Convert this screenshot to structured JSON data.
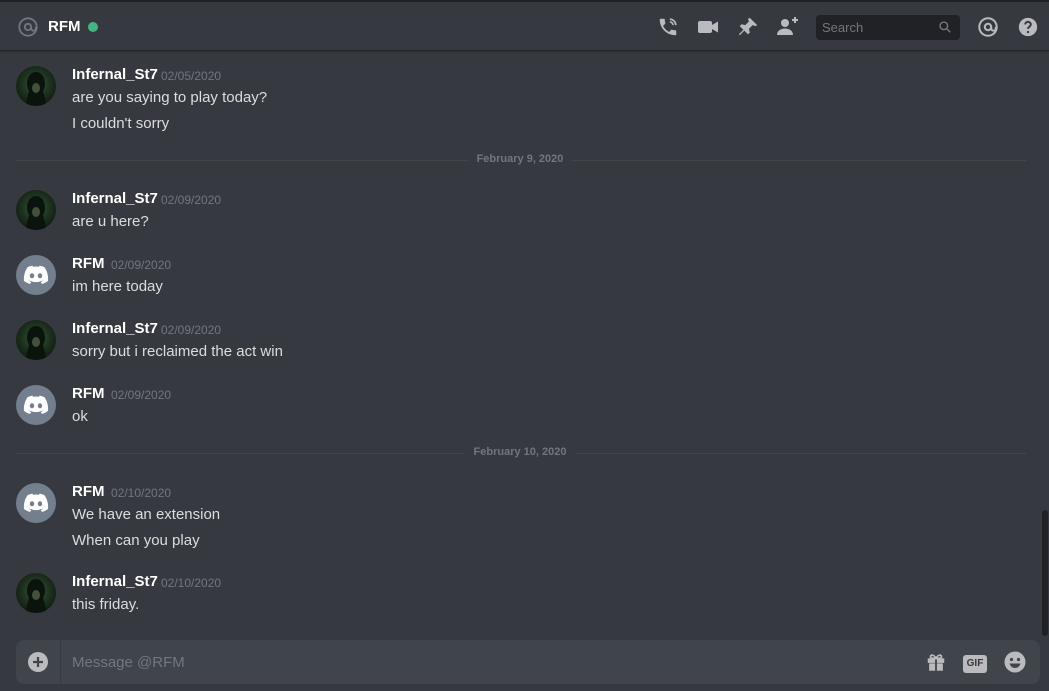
{
  "header": {
    "title": "RFM",
    "status_color": "#43b581",
    "icons": [
      "at-icon",
      "voice-call-icon",
      "video-call-icon",
      "pin-icon",
      "add-friend-icon",
      "mention-icon",
      "help-icon"
    ],
    "search_placeholder": "Search"
  },
  "messages": [
    {
      "author": "Infernal_St7",
      "timestamp": "02/05/2020",
      "lines": [
        "are you saying to play today?",
        "I couldn't sorry"
      ]
    },
    {
      "author": "Infernal_St7",
      "timestamp": "02/09/2020",
      "lines": [
        "are u here?"
      ]
    },
    {
      "author": "RFM",
      "timestamp": "02/09/2020",
      "lines": [
        "im here today"
      ]
    },
    {
      "author": "Infernal_St7",
      "timestamp": "02/09/2020",
      "lines": [
        "sorry but i reclaimed the act win"
      ]
    },
    {
      "author": "RFM",
      "timestamp": "02/09/2020",
      "lines": [
        "ok"
      ]
    },
    {
      "author": "RFM",
      "timestamp": "02/10/2020",
      "lines": [
        "We have an extension",
        "When can you play"
      ]
    },
    {
      "author": "Infernal_St7",
      "timestamp": "02/10/2020",
      "lines": [
        "this friday."
      ]
    }
  ],
  "dividers": [
    "February 9, 2020",
    "February 10, 2020"
  ],
  "composer": {
    "placeholder": "Message @RFM",
    "gif_label": "GIF"
  }
}
